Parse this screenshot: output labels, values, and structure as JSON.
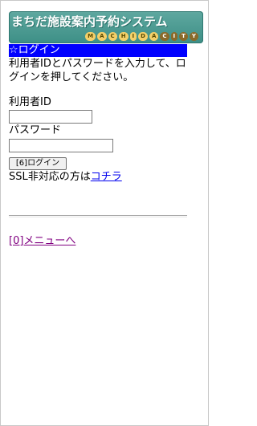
{
  "header": {
    "logo_title": "まちだ施設案内予約システム",
    "logo_badge": [
      "M",
      "A",
      "C",
      "H",
      "I",
      "D",
      "A",
      "C",
      "I",
      "T",
      "Y"
    ],
    "logo_color": "#4a9a92"
  },
  "login": {
    "heading": "☆ログイン",
    "instruction": "利用者IDとパスワードを入力して、ログインを押してください。",
    "user_id_label": "利用者ID",
    "user_id_value": "",
    "password_label": "パスワード",
    "password_value": "",
    "submit_label": "[6]ログイン",
    "ssl_text": "SSL非対応の方は",
    "ssl_link": "コチラ"
  },
  "footer": {
    "menu_link": "[0]メニューへ"
  },
  "colors": {
    "heading_bg": "#0000ff",
    "link": "#0000ee",
    "visited_link": "#800080"
  }
}
